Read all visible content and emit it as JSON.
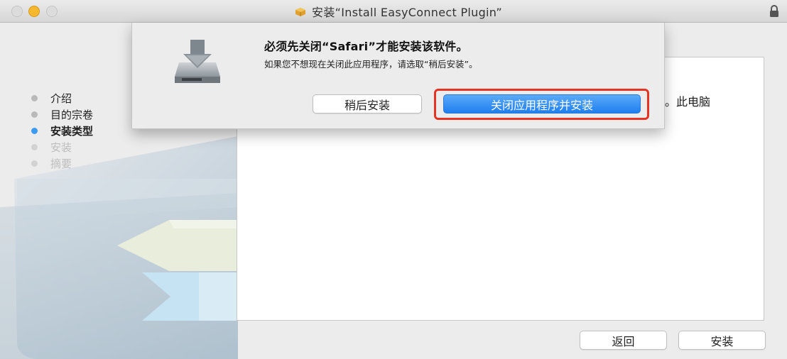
{
  "window": {
    "title": "安装“Install EasyConnect Plugin”",
    "icon": "package-icon"
  },
  "sidebar": {
    "steps": [
      {
        "label": "介绍",
        "state": "done"
      },
      {
        "label": "目的宗卷",
        "state": "done"
      },
      {
        "label": "安装类型",
        "state": "active"
      },
      {
        "label": "安装",
        "state": "pending"
      },
      {
        "label": "摘要",
        "state": "pending"
      }
    ]
  },
  "content": {
    "partial_text": "装。此电脑"
  },
  "dialog": {
    "icon": "installer-disk-icon",
    "title": "必须先关闭“Safari”才能安装该软件。",
    "message": "如果您不想现在关闭此应用程序，请选取“稍后安装”。",
    "later_label": "稍后安装",
    "close_install_label": "关闭应用程序并安装"
  },
  "footer": {
    "back_label": "返回",
    "install_label": "安装"
  },
  "colors": {
    "accent": "#3c9bf3",
    "highlight": "#e53324"
  }
}
